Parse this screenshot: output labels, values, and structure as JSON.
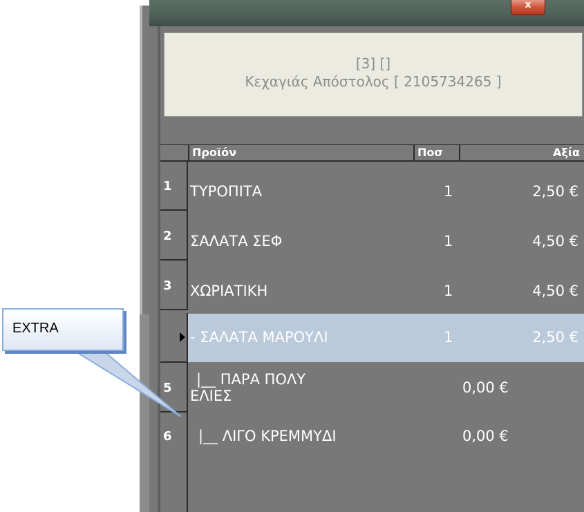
{
  "window": {
    "close_label": "x"
  },
  "customer": {
    "line1": "[3] []",
    "line2": "Κεχαγιάς Απόστολος [ 2105734265 ]"
  },
  "grid": {
    "columns": {
      "product": "Προϊόν",
      "qty": "Ποσ",
      "value": "Αξία"
    },
    "rows": [
      {
        "num": "1",
        "product": "ΤΥΡΟΠΙΤΑ",
        "qty": "1",
        "value": "2,50 €"
      },
      {
        "num": "2",
        "product": "ΣΑΛΑΤΑ ΣΕΦ",
        "qty": "1",
        "value": "4,50 €"
      },
      {
        "num": "3",
        "product": "ΧΩΡΙΑΤΙΚΗ",
        "qty": "1",
        "value": "4,50 €"
      },
      {
        "num": "",
        "product": "- ΣΑΛΑΤΑ ΜΑΡΟΥΛΙ",
        "qty": "1",
        "value": "2,50 €",
        "selected": true
      },
      {
        "num": "5",
        "product_line1": "|__ ΠΑΡΑ ΠΟΛΥ",
        "product_line2": "ΕΛΙΕΣ",
        "value": "0,00 €"
      },
      {
        "num": "6",
        "product": "|__ ΛΙΓΟ ΚΡΕΜΜΥΔΙ",
        "value": "0,00 €"
      }
    ]
  },
  "callout": {
    "text": "EXTRA"
  },
  "colors": {
    "grid_bg": "#787878",
    "selected_row": "#bacadb",
    "panel_bg": "#ecebe1",
    "callout_border": "#8aaedb"
  }
}
